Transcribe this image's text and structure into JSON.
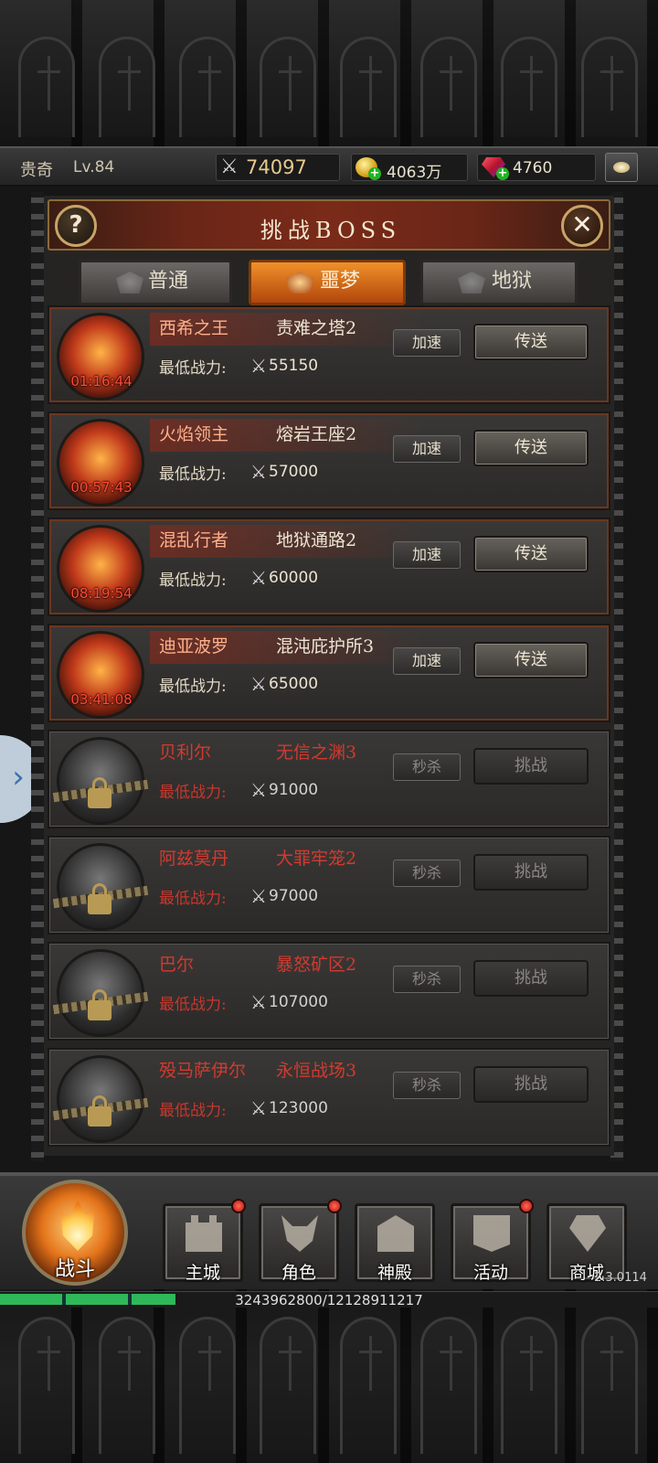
{
  "player": {
    "name": "贵奇",
    "level": "Lv.84",
    "power": "74097",
    "gold": "4063万",
    "gems": "4760"
  },
  "panel": {
    "title": "挑战BOSS",
    "help_label": "?",
    "close_label": "✕"
  },
  "tabs": [
    {
      "label": "普通",
      "active": false
    },
    {
      "label": "噩梦",
      "active": true
    },
    {
      "label": "地狱",
      "active": false
    }
  ],
  "min_power_label": "最低战力:",
  "bosses": [
    {
      "name": "西希之王",
      "location": "责难之塔2",
      "timer": "01:16:44",
      "min_power": "55150",
      "locked": false,
      "small_button": "加速",
      "big_button": "传送"
    },
    {
      "name": "火焰领主",
      "location": "熔岩王座2",
      "timer": "00:57:43",
      "min_power": "57000",
      "locked": false,
      "small_button": "加速",
      "big_button": "传送"
    },
    {
      "name": "混乱行者",
      "location": "地狱通路2",
      "timer": "08:19:54",
      "min_power": "60000",
      "locked": false,
      "small_button": "加速",
      "big_button": "传送"
    },
    {
      "name": "迪亚波罗",
      "location": "混沌庇护所3",
      "timer": "03:41:08",
      "min_power": "65000",
      "locked": false,
      "small_button": "加速",
      "big_button": "传送"
    },
    {
      "name": "贝利尔",
      "location": "无信之渊3",
      "timer": "",
      "min_power": "91000",
      "locked": true,
      "small_button": "秒杀",
      "big_button": "挑战"
    },
    {
      "name": "阿兹莫丹",
      "location": "大罪牢笼2",
      "timer": "",
      "min_power": "97000",
      "locked": true,
      "small_button": "秒杀",
      "big_button": "挑战"
    },
    {
      "name": "巴尔",
      "location": "暴怒矿区2",
      "timer": "",
      "min_power": "107000",
      "locked": true,
      "small_button": "秒杀",
      "big_button": "挑战"
    },
    {
      "name": "殁马萨伊尔",
      "location": "永恒战场3",
      "timer": "",
      "min_power": "123000",
      "locked": true,
      "small_button": "秒杀",
      "big_button": "挑战"
    }
  ],
  "nav": {
    "battle_label": "战斗",
    "items": [
      {
        "label": "主城",
        "icon": "castle-icon",
        "notify": true
      },
      {
        "label": "角色",
        "icon": "helmet-icon",
        "notify": true
      },
      {
        "label": "神殿",
        "icon": "temple-icon",
        "notify": false
      },
      {
        "label": "活动",
        "icon": "banner-icon",
        "notify": true
      },
      {
        "label": "商城",
        "icon": "diamond-icon",
        "notify": false
      }
    ]
  },
  "version": "2.3.0114",
  "exp": {
    "text": "3243962800/12128911217",
    "fraction": 0.267
  },
  "colors": {
    "accent_orange": "#e0741c",
    "locked_red": "#d13a30",
    "timer_red": "#ff4a3a",
    "gold": "#e6c98f"
  }
}
